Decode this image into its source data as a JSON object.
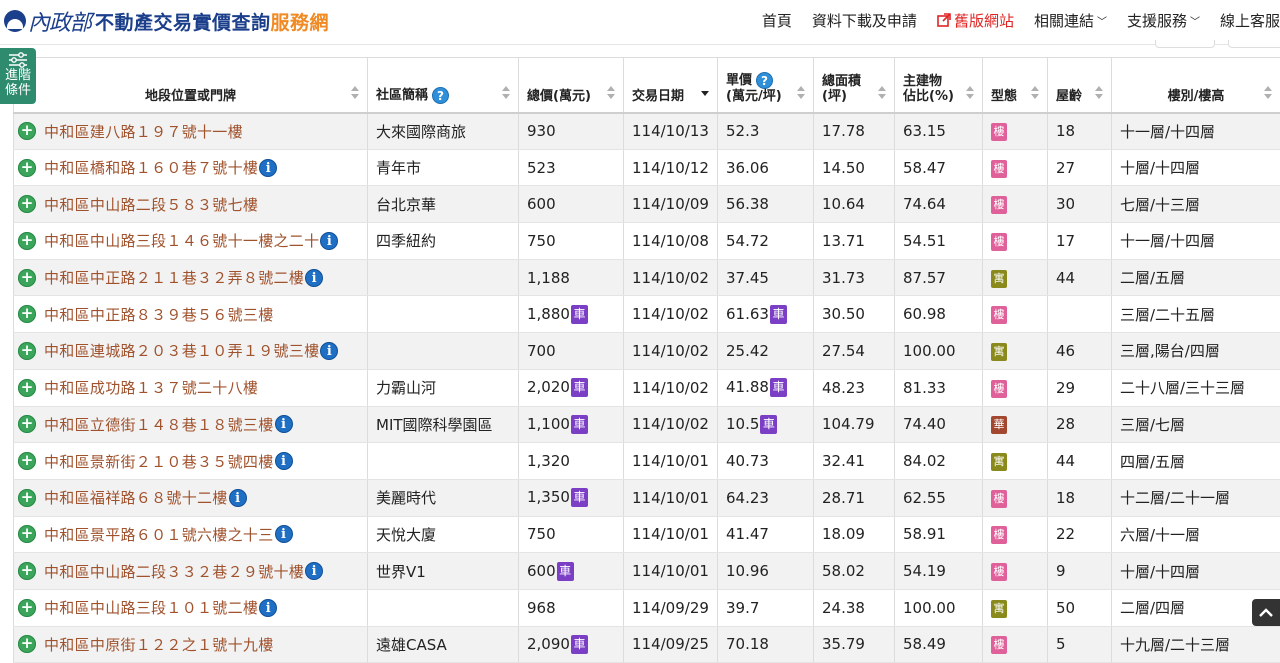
{
  "header": {
    "logo_mark": "內政部",
    "title_main": "不動產交易實價查詢",
    "title_accent": "服務網"
  },
  "nav": [
    {
      "label": "首頁",
      "name": "nav-home",
      "red": false,
      "chev": false,
      "ext": false
    },
    {
      "label": "資料下載及申請",
      "name": "nav-data-download",
      "red": false,
      "chev": false,
      "ext": false
    },
    {
      "label": "舊版網站",
      "name": "nav-old-site",
      "red": true,
      "chev": false,
      "ext": true
    },
    {
      "label": "相關連結",
      "name": "nav-related-links",
      "red": false,
      "chev": true,
      "ext": false
    },
    {
      "label": "支援服務",
      "name": "nav-support",
      "red": false,
      "chev": true,
      "ext": false
    },
    {
      "label": "線上客服",
      "name": "nav-online-service",
      "red": false,
      "chev": false,
      "ext": false
    }
  ],
  "advanced_filter": {
    "line1": "進階",
    "line2": "條件"
  },
  "columns": [
    {
      "key": "addr",
      "label1": "地段位置或門牌",
      "label2": "",
      "help": false,
      "center": true,
      "sort": "none"
    },
    {
      "key": "community",
      "label1": "社區簡稱",
      "label2": "",
      "help": true,
      "center": false,
      "sort": "none"
    },
    {
      "key": "total",
      "label1": "總價(萬元)",
      "label2": "",
      "help": false,
      "center": false,
      "sort": "none"
    },
    {
      "key": "date",
      "label1": "交易日期",
      "label2": "",
      "help": false,
      "center": false,
      "sort": "desc"
    },
    {
      "key": "unit",
      "label1": "單價",
      "label2": "(萬元/坪)",
      "help": true,
      "center": false,
      "sort": "none"
    },
    {
      "key": "area",
      "label1": "總面積",
      "label2": "(坪)",
      "help": false,
      "center": false,
      "sort": "none"
    },
    {
      "key": "ratio",
      "label1": "主建物",
      "label2": "佔比(%)",
      "help": false,
      "center": false,
      "sort": "none"
    },
    {
      "key": "type",
      "label1": "型態",
      "label2": "",
      "help": false,
      "center": false,
      "sort": "none"
    },
    {
      "key": "age",
      "label1": "屋齡",
      "label2": "",
      "help": false,
      "center": false,
      "sort": "none"
    },
    {
      "key": "floor",
      "label1": "樓別/樓高",
      "label2": "",
      "help": false,
      "center": true,
      "sort": "none"
    }
  ],
  "badges": {
    "car": "車",
    "info": "i",
    "help": "?"
  },
  "rows": [
    {
      "addr": "中和區建八路１９７號十一樓",
      "info": false,
      "community": "大來國際商旅",
      "total": "930",
      "total_car": false,
      "date": "114/10/13",
      "unit": "52.3",
      "unit_car": false,
      "area": "17.78",
      "ratio": "63.15",
      "type": "樓",
      "type_color": "pink",
      "age": "18",
      "floor": "十一層/十四層"
    },
    {
      "addr": "中和區橋和路１６０巷７號十樓",
      "info": true,
      "community": "青年市",
      "total": "523",
      "total_car": false,
      "date": "114/10/12",
      "unit": "36.06",
      "unit_car": false,
      "area": "14.50",
      "ratio": "58.47",
      "type": "樓",
      "type_color": "pink",
      "age": "27",
      "floor": "十層/十四層"
    },
    {
      "addr": "中和區中山路二段５８３號七樓",
      "info": false,
      "community": "台北京華",
      "total": "600",
      "total_car": false,
      "date": "114/10/09",
      "unit": "56.38",
      "unit_car": false,
      "area": "10.64",
      "ratio": "74.64",
      "type": "樓",
      "type_color": "pink",
      "age": "30",
      "floor": "七層/十三層"
    },
    {
      "addr": "中和區中山路三段１４６號十一樓之二十",
      "info": true,
      "community": "四季紐約",
      "total": "750",
      "total_car": false,
      "date": "114/10/08",
      "unit": "54.72",
      "unit_car": false,
      "area": "13.71",
      "ratio": "54.51",
      "type": "樓",
      "type_color": "pink",
      "age": "17",
      "floor": "十一層/十四層"
    },
    {
      "addr": "中和區中正路２１１巷３２弄８號二樓",
      "info": true,
      "community": "",
      "total": "1,188",
      "total_car": false,
      "date": "114/10/02",
      "unit": "37.45",
      "unit_car": false,
      "area": "31.73",
      "ratio": "87.57",
      "type": "寓",
      "type_color": "olive",
      "age": "44",
      "floor": "二層/五層"
    },
    {
      "addr": "中和區中正路８３９巷５６號三樓",
      "info": false,
      "community": "",
      "total": "1,880",
      "total_car": true,
      "date": "114/10/02",
      "unit": "61.63",
      "unit_car": true,
      "area": "30.50",
      "ratio": "60.98",
      "type": "樓",
      "type_color": "pink",
      "age": "",
      "floor": "三層/二十五層"
    },
    {
      "addr": "中和區連城路２０３巷１０弄１９號三樓",
      "info": true,
      "community": "",
      "total": "700",
      "total_car": false,
      "date": "114/10/02",
      "unit": "25.42",
      "unit_car": false,
      "area": "27.54",
      "ratio": "100.00",
      "type": "寓",
      "type_color": "olive",
      "age": "46",
      "floor": "三層,陽台/四層"
    },
    {
      "addr": "中和區成功路１３７號二十八樓",
      "info": false,
      "community": "力霸山河",
      "total": "2,020",
      "total_car": true,
      "date": "114/10/02",
      "unit": "41.88",
      "unit_car": true,
      "area": "48.23",
      "ratio": "81.33",
      "type": "樓",
      "type_color": "pink",
      "age": "29",
      "floor": "二十八層/三十三層"
    },
    {
      "addr": "中和區立德街１４８巷１８號三樓",
      "info": true,
      "community": "MIT國際科學園區",
      "total": "1,100",
      "total_car": true,
      "date": "114/10/02",
      "unit": "10.5",
      "unit_car": true,
      "area": "104.79",
      "ratio": "74.40",
      "type": "華",
      "type_color": "brown",
      "age": "28",
      "floor": "三層/七層"
    },
    {
      "addr": "中和區景新街２１０巷３５號四樓",
      "info": true,
      "community": "",
      "total": "1,320",
      "total_car": false,
      "date": "114/10/01",
      "unit": "40.73",
      "unit_car": false,
      "area": "32.41",
      "ratio": "84.02",
      "type": "寓",
      "type_color": "olive",
      "age": "44",
      "floor": "四層/五層"
    },
    {
      "addr": "中和區福祥路６８號十二樓",
      "info": true,
      "community": "美麗時代",
      "total": "1,350",
      "total_car": true,
      "date": "114/10/01",
      "unit": "64.23",
      "unit_car": false,
      "area": "28.71",
      "ratio": "62.55",
      "type": "樓",
      "type_color": "pink",
      "age": "18",
      "floor": "十二層/二十一層"
    },
    {
      "addr": "中和區景平路６０１號六樓之十三",
      "info": true,
      "community": "天悅大廈",
      "total": "750",
      "total_car": false,
      "date": "114/10/01",
      "unit": "41.47",
      "unit_car": false,
      "area": "18.09",
      "ratio": "58.91",
      "type": "樓",
      "type_color": "pink",
      "age": "22",
      "floor": "六層/十一層"
    },
    {
      "addr": "中和區中山路二段３３２巷２９號十樓",
      "info": true,
      "community": "世界V1",
      "total": "600",
      "total_car": true,
      "date": "114/10/01",
      "unit": "10.96",
      "unit_car": false,
      "area": "58.02",
      "ratio": "54.19",
      "type": "樓",
      "type_color": "pink",
      "age": "9",
      "floor": "十層/十四層"
    },
    {
      "addr": "中和區中山路三段１０１號二樓",
      "info": true,
      "community": "",
      "total": "968",
      "total_car": false,
      "date": "114/09/29",
      "unit": "39.7",
      "unit_car": false,
      "area": "24.38",
      "ratio": "100.00",
      "type": "寓",
      "type_color": "olive",
      "age": "50",
      "floor": "二層/四層"
    },
    {
      "addr": "中和區中原街１２２之１號十九樓",
      "info": false,
      "community": "遠雄CASA",
      "total": "2,090",
      "total_car": true,
      "date": "114/09/25",
      "unit": "70.18",
      "unit_car": false,
      "area": "35.79",
      "ratio": "58.49",
      "type": "樓",
      "type_color": "pink",
      "age": "5",
      "floor": "十九層/二十三層"
    }
  ]
}
